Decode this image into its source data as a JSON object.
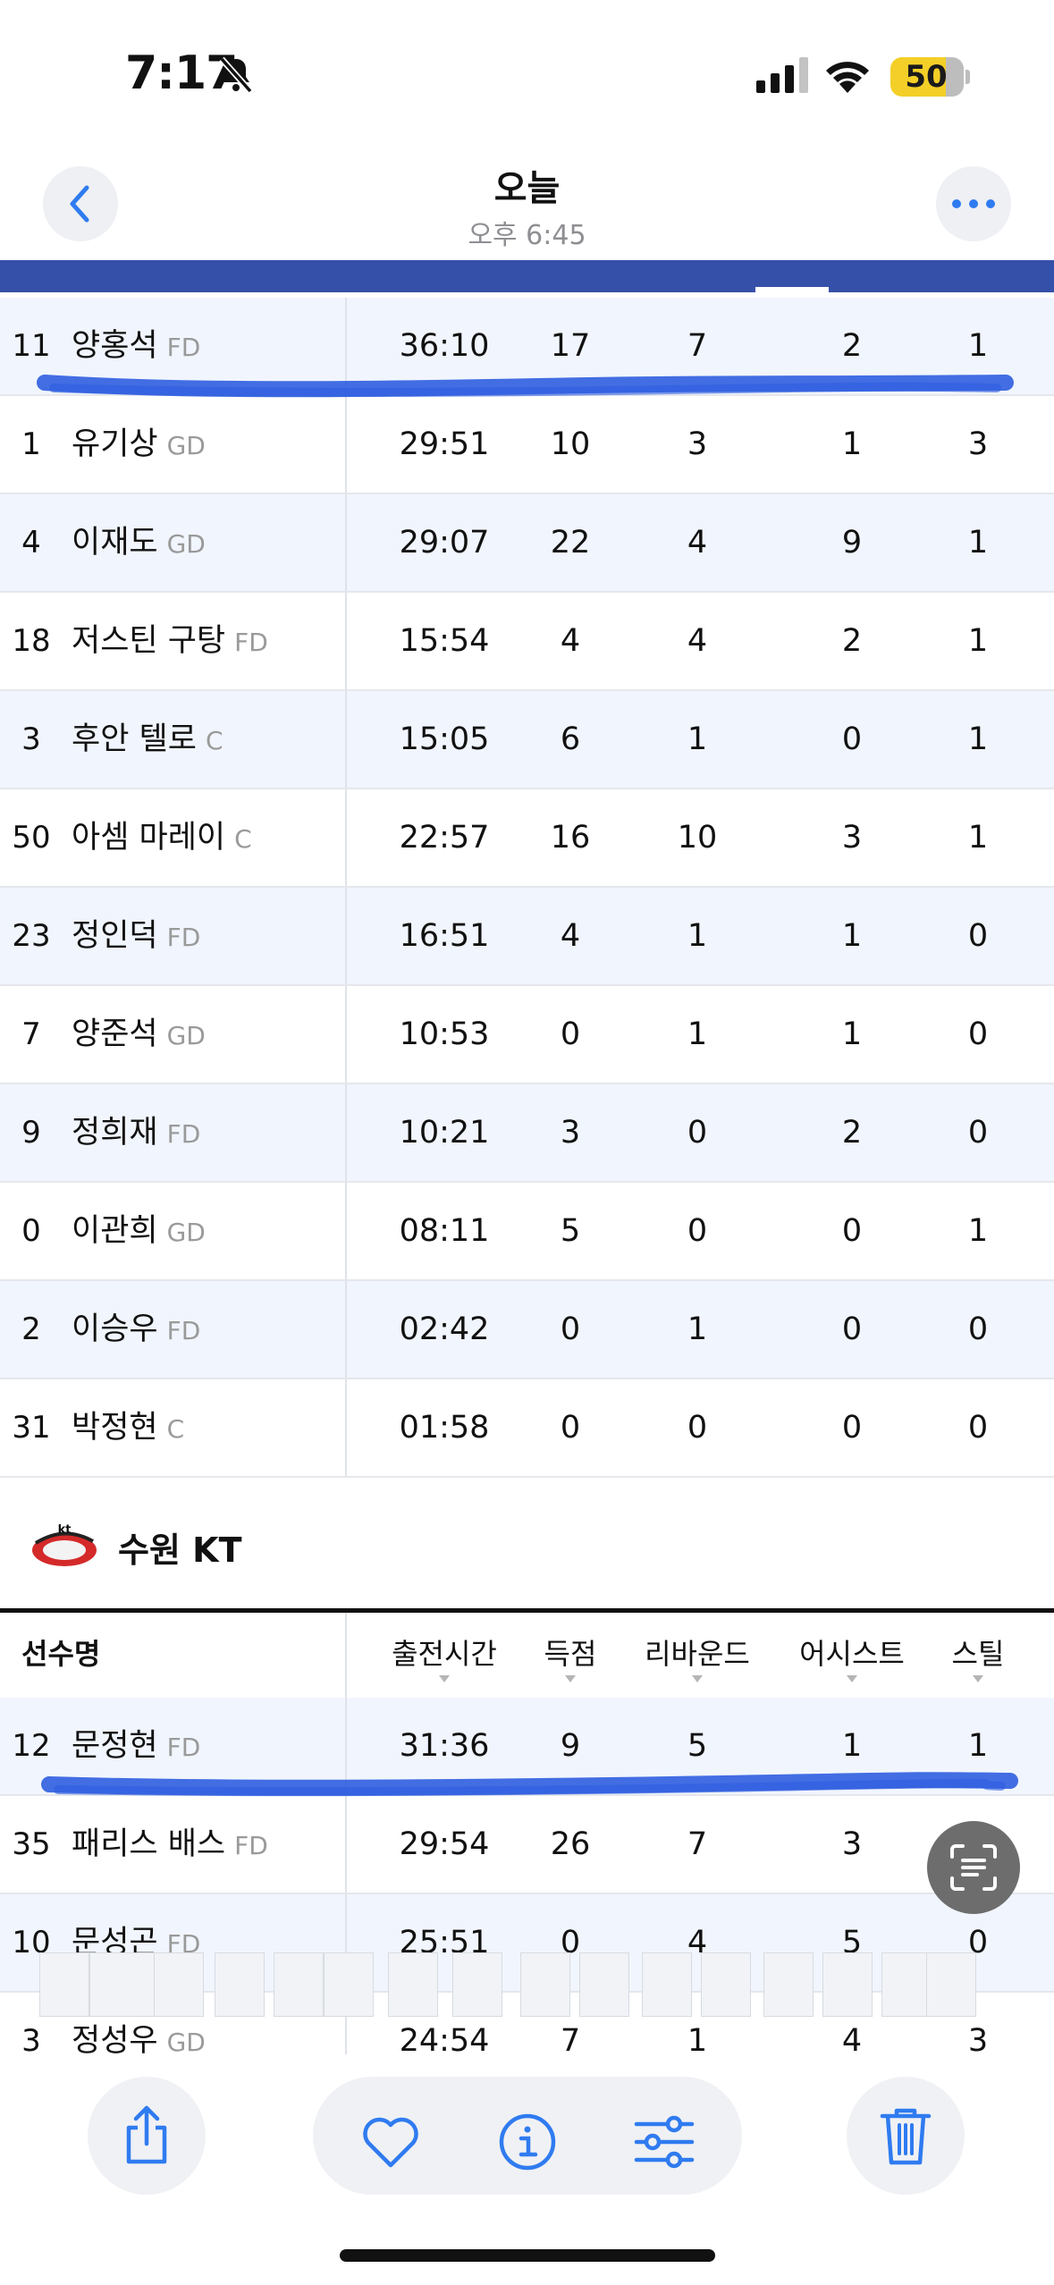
{
  "status_bar": {
    "time": "7:17",
    "battery": "50"
  },
  "nav": {
    "title": "오늘",
    "subtitle": "오후 6:45"
  },
  "top_table": {
    "rows": [
      {
        "num": "11",
        "name": "양홍석",
        "pos": "FD",
        "time": "36:10",
        "pts": "17",
        "reb": "7",
        "ast": "2",
        "stl": "1"
      },
      {
        "num": "1",
        "name": "유기상",
        "pos": "GD",
        "time": "29:51",
        "pts": "10",
        "reb": "3",
        "ast": "1",
        "stl": "3"
      },
      {
        "num": "4",
        "name": "이재도",
        "pos": "GD",
        "time": "29:07",
        "pts": "22",
        "reb": "4",
        "ast": "9",
        "stl": "1"
      },
      {
        "num": "18",
        "name": "저스틴 구탕",
        "pos": "FD",
        "time": "15:54",
        "pts": "4",
        "reb": "4",
        "ast": "2",
        "stl": "1"
      },
      {
        "num": "3",
        "name": "후안 텔로",
        "pos": "C",
        "time": "15:05",
        "pts": "6",
        "reb": "1",
        "ast": "0",
        "stl": "1"
      },
      {
        "num": "50",
        "name": "아셈 마레이",
        "pos": "C",
        "time": "22:57",
        "pts": "16",
        "reb": "10",
        "ast": "3",
        "stl": "1"
      },
      {
        "num": "23",
        "name": "정인덕",
        "pos": "FD",
        "time": "16:51",
        "pts": "4",
        "reb": "1",
        "ast": "1",
        "stl": "0"
      },
      {
        "num": "7",
        "name": "양준석",
        "pos": "GD",
        "time": "10:53",
        "pts": "0",
        "reb": "1",
        "ast": "1",
        "stl": "0"
      },
      {
        "num": "9",
        "name": "정희재",
        "pos": "FD",
        "time": "10:21",
        "pts": "3",
        "reb": "0",
        "ast": "2",
        "stl": "0"
      },
      {
        "num": "0",
        "name": "이관희",
        "pos": "GD",
        "time": "08:11",
        "pts": "5",
        "reb": "0",
        "ast": "0",
        "stl": "1"
      },
      {
        "num": "2",
        "name": "이승우",
        "pos": "FD",
        "time": "02:42",
        "pts": "0",
        "reb": "1",
        "ast": "0",
        "stl": "0"
      },
      {
        "num": "31",
        "name": "박정현",
        "pos": "C",
        "time": "01:58",
        "pts": "0",
        "reb": "0",
        "ast": "0",
        "stl": "0"
      }
    ]
  },
  "team2": {
    "name": "수원 KT",
    "logo_text": "kt"
  },
  "bottom_table": {
    "headers": [
      "선수명",
      "출전시간",
      "득점",
      "리바운드",
      "어시스트",
      "스틸"
    ],
    "rows": [
      {
        "num": "12",
        "name": "문정현",
        "pos": "FD",
        "time": "31:36",
        "pts": "9",
        "reb": "5",
        "ast": "1",
        "stl": "1"
      },
      {
        "num": "35",
        "name": "패리스 배스",
        "pos": "FD",
        "time": "29:54",
        "pts": "26",
        "reb": "7",
        "ast": "3",
        "stl": ""
      },
      {
        "num": "10",
        "name": "문성곤",
        "pos": "FD",
        "time": "25:51",
        "pts": "0",
        "reb": "4",
        "ast": "5",
        "stl": "0"
      },
      {
        "num": "3",
        "name": "정성우",
        "pos": "GD",
        "time": "24:54",
        "pts": "7",
        "reb": "1",
        "ast": "4",
        "stl": "3"
      }
    ]
  },
  "colors": {
    "accent": "#3550a8",
    "row_alt": "#f1f5fd",
    "scribble": "#2f5ee0",
    "icon_blue": "#2f7bf0"
  },
  "icons": [
    "back-chevron-icon",
    "more-icon",
    "share-icon",
    "heart-icon",
    "info-icon",
    "adjust-icon",
    "trash-icon",
    "live-text-icon",
    "bell-slash-icon",
    "signal-icon",
    "wifi-icon"
  ]
}
